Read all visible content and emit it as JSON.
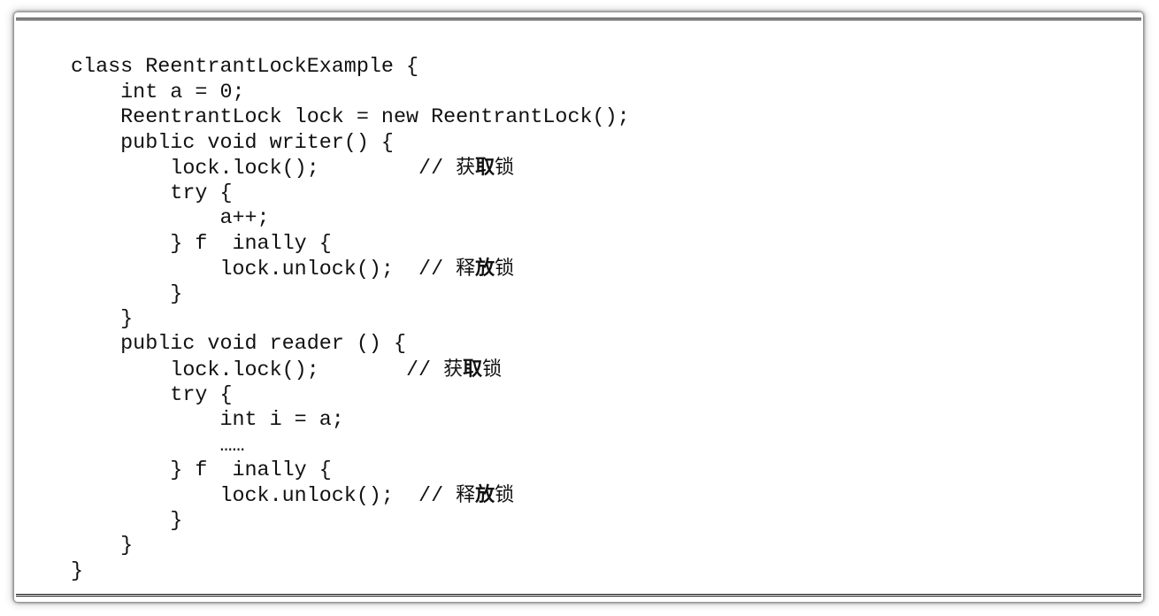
{
  "code": {
    "lines": [
      "class ReentrantLockExample {",
      "    int a = 0;",
      "    ReentrantLock lock = new ReentrantLock();",
      "    public void writer() {",
      "        lock.lock();        // ",
      "        try {",
      "            a++;",
      "        } f  inally {",
      "            lock.unlock();  // ",
      "        }",
      "    }",
      "    public void reader () {",
      "        lock.lock();       // ",
      "        try {",
      "            int i = a;",
      "            ……",
      "        } f  inally {",
      "            lock.unlock();  // ",
      "        }",
      "    }",
      "}"
    ],
    "comments": {
      "acquire": [
        "获",
        "取",
        "锁"
      ],
      "release": [
        "释",
        "放",
        "锁"
      ]
    }
  }
}
